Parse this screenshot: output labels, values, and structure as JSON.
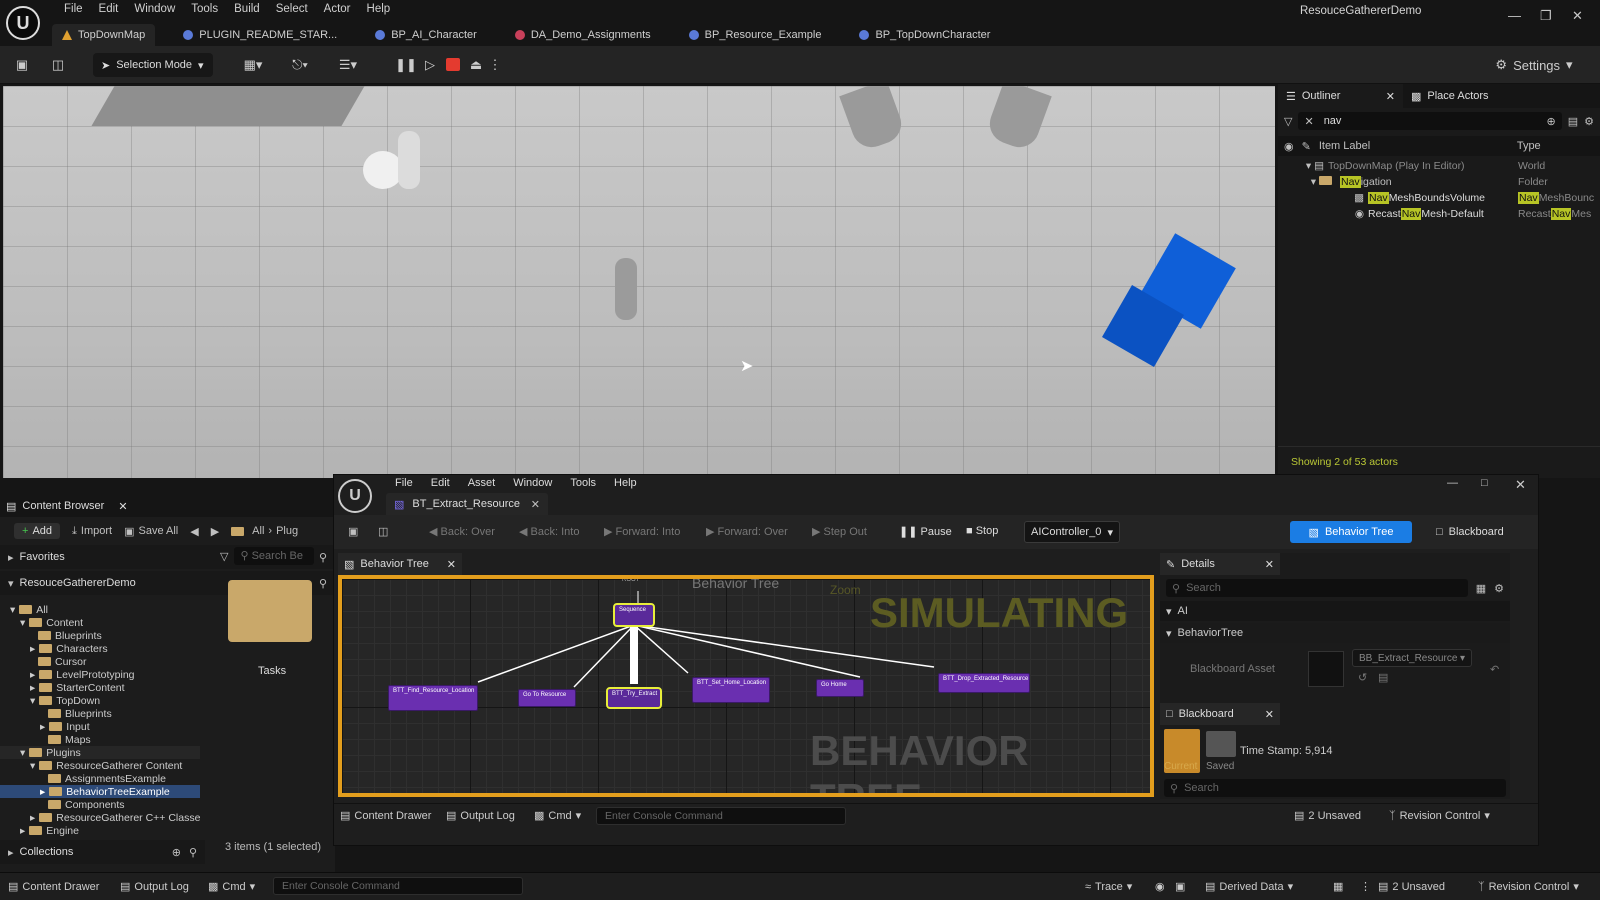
{
  "menu": [
    "File",
    "Edit",
    "Window",
    "Tools",
    "Build",
    "Select",
    "Actor",
    "Help"
  ],
  "app_title": "ResouceGathererDemo",
  "tabs": [
    "TopDownMap",
    "PLUGIN_README_STAR...",
    "BP_AI_Character",
    "DA_Demo_Assignments",
    "BP_Resource_Example",
    "BP_TopDownCharacter"
  ],
  "toolbar": {
    "selection_mode": "Selection Mode",
    "settings": "Settings"
  },
  "outliner": {
    "tab": "Outliner",
    "place_actors": "Place Actors",
    "search_value": "nav",
    "col_label": "Item Label",
    "col_type": "Type",
    "rows": [
      {
        "pre": "TopDownMap (Play In Editor)",
        "hl": "",
        "post": "",
        "type": "World",
        "type_hl": "",
        "type_post": ""
      },
      {
        "pre": "",
        "hl": "Nav",
        "post": "igation",
        "type": "Folder",
        "type_hl": "",
        "type_post": ""
      },
      {
        "pre": "",
        "hl": "Nav",
        "post": "MeshBoundsVolume",
        "type": "",
        "type_hl": "Nav",
        "type_post": "MeshBounc"
      },
      {
        "pre": "Recast",
        "hl": "Nav",
        "post": "Mesh-Default",
        "type": "Recast",
        "type_hl": "Nav",
        "type_post": "Mes"
      }
    ],
    "footer": "Showing 2 of 53 actors"
  },
  "content_browser": {
    "tab": "Content Browser",
    "add": "Add",
    "import": "Import",
    "save_all": "Save All",
    "path_all": "All",
    "path_plug": "Plug",
    "search_placeholder": "Search Be",
    "favorites": "Favorites",
    "project": "ResouceGathererDemo",
    "collections": "Collections",
    "items_count": "3 items (1 selected)",
    "tile_label": "Tasks",
    "tree": [
      {
        "label": "All",
        "indent": 0
      },
      {
        "label": "Content",
        "indent": 1
      },
      {
        "label": "Blueprints",
        "indent": 2
      },
      {
        "label": "Characters",
        "indent": 2
      },
      {
        "label": "Cursor",
        "indent": 2
      },
      {
        "label": "LevelPrototyping",
        "indent": 2
      },
      {
        "label": "StarterContent",
        "indent": 2
      },
      {
        "label": "TopDown",
        "indent": 2
      },
      {
        "label": "Blueprints",
        "indent": 3
      },
      {
        "label": "Input",
        "indent": 3
      },
      {
        "label": "Maps",
        "indent": 3
      },
      {
        "label": "Plugins",
        "indent": 1
      },
      {
        "label": "ResourceGatherer Content",
        "indent": 2
      },
      {
        "label": "AssignmentsExample",
        "indent": 3
      },
      {
        "label": "BehaviorTreeExample",
        "indent": 3
      },
      {
        "label": "Components",
        "indent": 3
      },
      {
        "label": "ResourceGatherer C++ Classe",
        "indent": 2
      },
      {
        "label": "Engine",
        "indent": 1
      }
    ]
  },
  "bte": {
    "menu": [
      "File",
      "Edit",
      "Asset",
      "Window",
      "Tools",
      "Help"
    ],
    "tab": "BT_Extract_Resource",
    "debug": [
      "Back: Over",
      "Back: Into",
      "Forward: Into",
      "Forward: Over",
      "Step Out"
    ],
    "pause": "Pause",
    "stop": "Stop",
    "controller": "AIController_0",
    "mode_bt": "Behavior Tree",
    "mode_bb": "Blackboard",
    "graph_tab": "Behavior Tree",
    "graph_title": "Behavior Tree",
    "simulating": "SIMULATING",
    "watermark": "BEHAVIOR TREE",
    "zoom": "Zoom",
    "nodes": {
      "root": "ROOT",
      "sequence": "Sequence",
      "n1": "BTT_Find_Resource_Location",
      "n2": "Go To Resource",
      "n3": "BTT_Try_Extract",
      "n4": "BTT_Set_Home_Location",
      "n5": "Go Home",
      "n6": "BTT_Drop_Extracted_Resource"
    },
    "details": {
      "tab": "Details",
      "search": "Search",
      "cat_ai": "AI",
      "cat_bt": "BehaviorTree",
      "bb_asset_label": "Blackboard Asset",
      "bb_asset_value": "BB_Extract_Resource"
    },
    "blackboard": {
      "tab": "Blackboard",
      "current": "Current",
      "saved": "Saved",
      "timestamp": "Time Stamp: 5,914",
      "search": "Search"
    },
    "bottom": {
      "content_drawer": "Content Drawer",
      "output_log": "Output Log",
      "cmd": "Cmd",
      "console_placeholder": "Enter Console Command",
      "unsaved": "2 Unsaved",
      "revision": "Revision Control"
    }
  },
  "status": {
    "content_drawer": "Content Drawer",
    "output_log": "Output Log",
    "cmd": "Cmd",
    "console_placeholder": "Enter Console Command",
    "trace": "Trace",
    "derived_data": "Derived Data",
    "unsaved": "2 Unsaved",
    "revision": "Revision Control"
  }
}
